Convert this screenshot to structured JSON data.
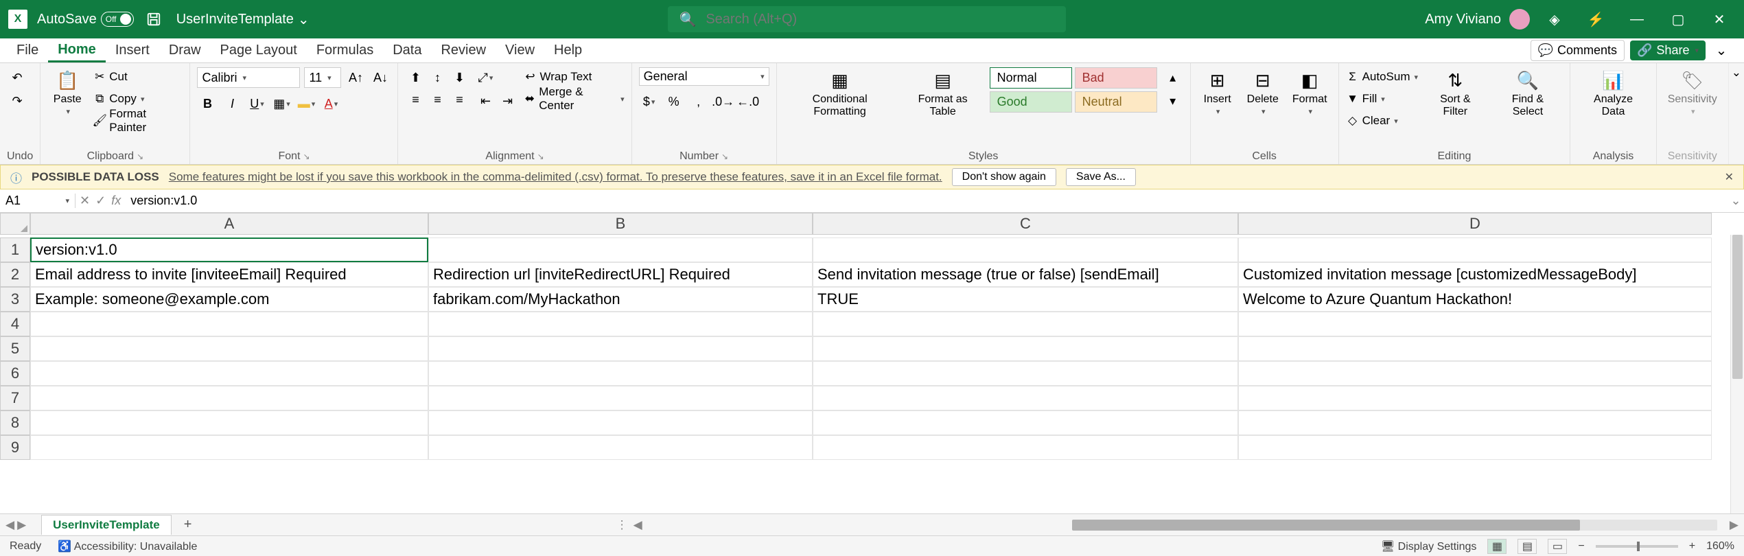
{
  "title": {
    "autosave_label": "AutoSave",
    "autosave_state": "Off",
    "filename": "UserInviteTemplate",
    "search_placeholder": "Search (Alt+Q)",
    "username": "Amy Viviano"
  },
  "tabs": {
    "file": "File",
    "home": "Home",
    "insert": "Insert",
    "draw": "Draw",
    "page_layout": "Page Layout",
    "formulas": "Formulas",
    "data": "Data",
    "review": "Review",
    "view": "View",
    "help": "Help",
    "comments": "Comments",
    "share": "Share"
  },
  "ribbon": {
    "undo": "Undo",
    "paste": "Paste",
    "cut": "Cut",
    "copy": "Copy",
    "format_painter": "Format Painter",
    "clipboard": "Clipboard",
    "font_name": "Calibri",
    "font_size": "11",
    "font": "Font",
    "wrap": "Wrap Text",
    "merge": "Merge & Center",
    "alignment": "Alignment",
    "numfmt": "General",
    "number": "Number",
    "cond": "Conditional Formatting",
    "fat": "Format as Table",
    "normal": "Normal",
    "bad": "Bad",
    "good": "Good",
    "neutral": "Neutral",
    "styles": "Styles",
    "insert_c": "Insert",
    "delete": "Delete",
    "format": "Format",
    "cells": "Cells",
    "autosum": "AutoSum",
    "fill": "Fill",
    "clear": "Clear",
    "sort": "Sort & Filter",
    "find": "Find & Select",
    "analyze": "Analyze Data",
    "editing": "Editing",
    "analysis": "Analysis",
    "sensitivity": "Sensitivity",
    "sensitivity_g": "Sensitivity"
  },
  "infobar": {
    "title": "POSSIBLE DATA LOSS",
    "msg": "Some features might be lost if you save this workbook in the comma-delimited (.csv) format. To preserve these features, save it in an Excel file format.",
    "dont": "Don't show again",
    "saveas": "Save As..."
  },
  "formula": {
    "ref": "A1",
    "value": "version:v1.0"
  },
  "cols": [
    "A",
    "B",
    "C",
    "D"
  ],
  "rows": [
    "1",
    "2",
    "3",
    "4",
    "5",
    "6",
    "7",
    "8",
    "9"
  ],
  "cells": {
    "A1": "version:v1.0",
    "A2": "Email address to invite [inviteeEmail] Required",
    "B2": "Redirection url [inviteRedirectURL] Required",
    "C2": "Send invitation message (true or false) [sendEmail]",
    "D2": "Customized invitation message [customizedMessageBody]",
    "A3": "Example:    someone@example.com",
    "B3": "fabrikam.com/MyHackathon",
    "C3": "TRUE",
    "D3": "Welcome to Azure Quantum Hackathon!"
  },
  "sheet": {
    "name": "UserInviteTemplate"
  },
  "status": {
    "ready": "Ready",
    "access": "Accessibility: Unavailable",
    "display": "Display Settings",
    "zoom": "160%"
  }
}
